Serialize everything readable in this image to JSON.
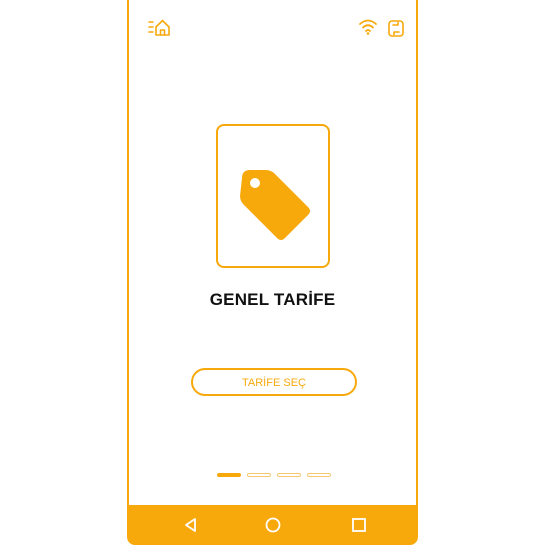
{
  "colors": {
    "accent": "#f7a90c",
    "text": "#111111",
    "background": "#ffffff"
  },
  "status_bar": {
    "left_icon": "home-list-icon",
    "right_icons": [
      "wifi-icon",
      "sync-icon"
    ]
  },
  "tariff": {
    "icon": "price-tag-icon",
    "title": "GENEL TARİFE"
  },
  "actions": {
    "select_label": "TARİFE SEÇ"
  },
  "pager": {
    "total_pages": 4,
    "active_page": 1
  },
  "navbar": {
    "buttons": [
      "back-icon",
      "home-icon",
      "recents-icon"
    ]
  }
}
